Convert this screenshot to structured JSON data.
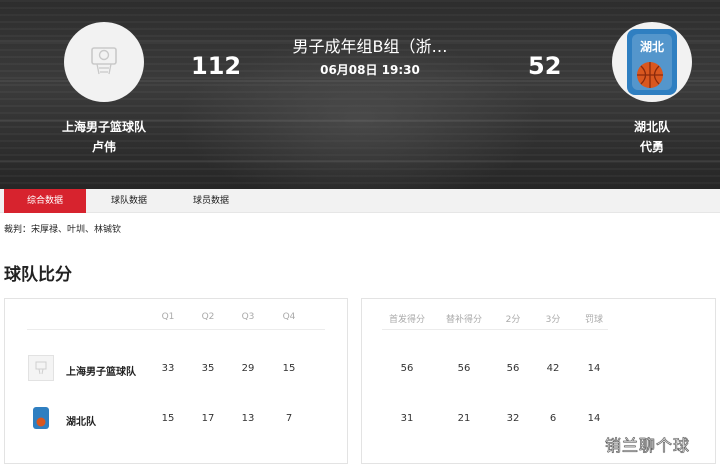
{
  "match": {
    "title": "男子成年组B组（浙…",
    "time": "06月08日 19:30"
  },
  "home": {
    "name": "上海男子篮球队",
    "coach": "卢伟",
    "score": "112",
    "row_name": "上海男子篮球队",
    "quarters": [
      "33",
      "35",
      "29",
      "15"
    ],
    "stats": [
      "56",
      "56",
      "56",
      "42",
      "14"
    ]
  },
  "away": {
    "name": "湖北队",
    "coach": "代勇",
    "score": "52",
    "logo_text": "湖北",
    "row_name": "湖北队",
    "quarters": [
      "15",
      "17",
      "13",
      "7"
    ],
    "stats": [
      "31",
      "21",
      "32",
      "6",
      "14"
    ]
  },
  "tabs": [
    "综合数据",
    "球队数据",
    "球员数据"
  ],
  "referees": "裁判：宋厚禄、叶圳、林铖钦",
  "section_title": "球队比分",
  "quarter_headers": [
    "Q1",
    "Q2",
    "Q3",
    "Q4"
  ],
  "stat_headers": [
    "首发得分",
    "替补得分",
    "2分",
    "3分",
    "罚球"
  ],
  "watermark": "销兰聊个球",
  "colors": {
    "accent": "#d7232e",
    "banner": "#2f2f2f"
  }
}
